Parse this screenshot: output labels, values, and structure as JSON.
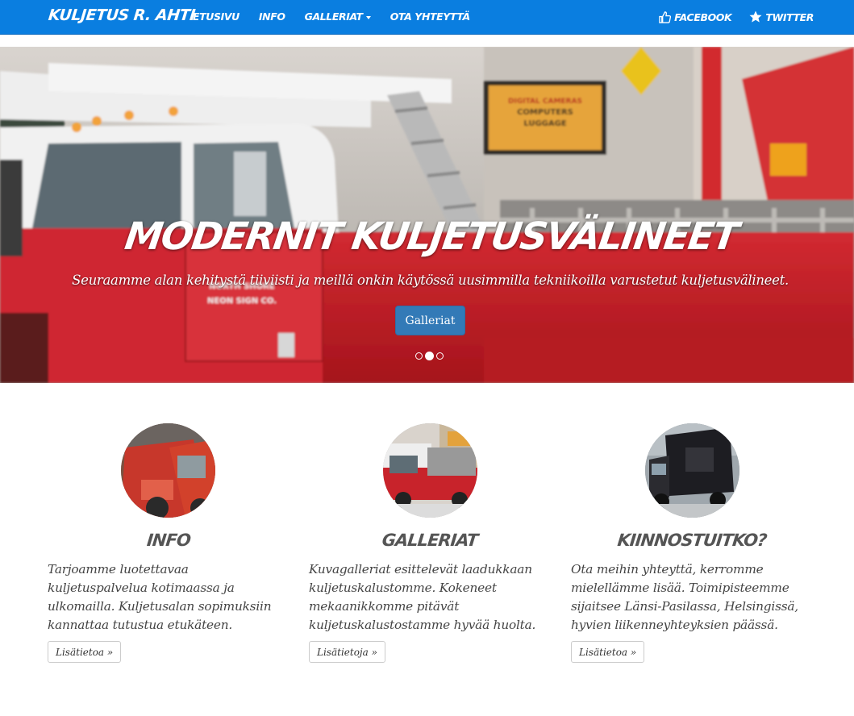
{
  "navbar": {
    "brand": "Kuljetus R. Ahti",
    "links": [
      {
        "label": "Etusivu"
      },
      {
        "label": "Info"
      },
      {
        "label": "Galleriat"
      },
      {
        "label": "Ota yhteyttä"
      }
    ],
    "social": [
      {
        "label": "Facebook",
        "icon": "thumbs-up-icon"
      },
      {
        "label": "Twitter",
        "icon": "star-icon"
      }
    ]
  },
  "carousel": {
    "title": "Modernit kuljetusvälineet",
    "subtitle": "Seuraamme alan kehitystä tiiviisti ja meillä onkin käytössä uusimmilla tekniikoilla varustetut kuljetusvälineet.",
    "button_label": "Galleriat",
    "slide_count": 3,
    "active_slide": 2,
    "image_signs": {
      "store_sign": "DIGITAL CAMERAS COMPUTERS LUGGAGE",
      "truck_door": "NORTH SHORE NEON SIGN CO."
    }
  },
  "features": [
    {
      "title": "Info",
      "text": "Tarjoamme luotettavaa kuljetuspalvelua kotimaassa ja ulkomailla. Kuljetusalan sopimuksiin kannattaa tutustua etukäteen.",
      "button_label": "Lisätietoa »"
    },
    {
      "title": "Galleriat",
      "text": "Kuvagalleriat esittelevät laadukkaan kuljetuskalustomme. Kokeneet mekaanikkomme pitävät kuljetuskalustostamme hyvää huolta.",
      "button_label": "Lisätietoja »"
    },
    {
      "title": "Kiinnostuitko?",
      "text": "Ota meihin yhteyttä, kerromme mielellämme lisää. Toimipisteemme sijaitsee Länsi-Pasilassa, Helsingissä, hyvien liikenneyhteyksien päässä.",
      "button_label": "Lisätietoa »"
    }
  ],
  "colors": {
    "navbar": "#0a7ee0",
    "primary_button": "#337ab7",
    "truck_red": "#c8202a"
  }
}
